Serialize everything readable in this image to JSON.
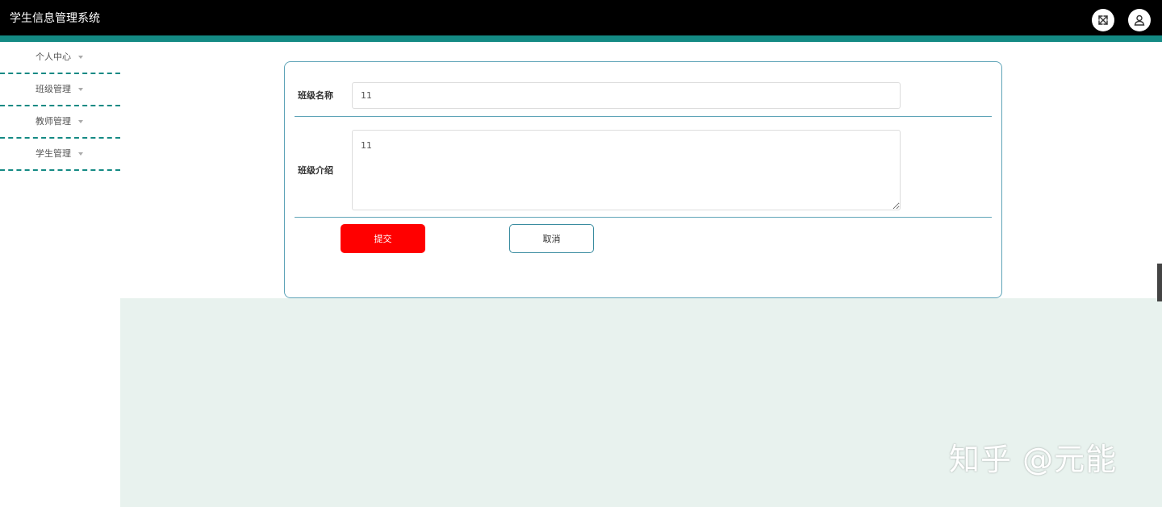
{
  "header": {
    "title": "学生信息管理系统",
    "fullscreen_icon": "fullscreen-toggle-icon",
    "user_icon": "user-icon"
  },
  "colors": {
    "topbar": "#000000",
    "accent": "#148a84",
    "card_border": "#5fa4b8",
    "submit": "#ff0000",
    "content_bg": "#e8f2ee"
  },
  "sidebar": {
    "items": [
      {
        "label": "个人中心"
      },
      {
        "label": "班级管理"
      },
      {
        "label": "教师管理"
      },
      {
        "label": "学生管理"
      }
    ]
  },
  "form": {
    "class_name_label": "班级名称",
    "class_name_value": "11",
    "class_intro_label": "班级介绍",
    "class_intro_value": "11",
    "submit_label": "提交",
    "cancel_label": "取消"
  },
  "watermark": "知乎 @元能"
}
